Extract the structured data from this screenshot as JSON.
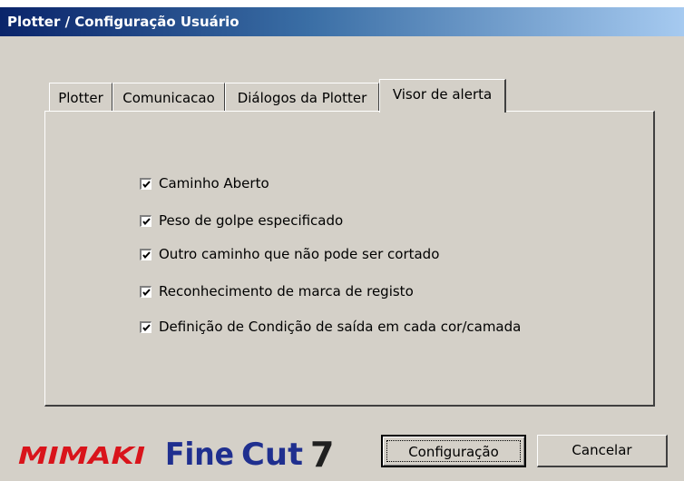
{
  "window": {
    "title": "Plotter / Configuração Usuário"
  },
  "tabs": [
    {
      "label": "Plotter",
      "active": false
    },
    {
      "label": "Comunicacao",
      "active": false
    },
    {
      "label": "Diálogos da Plotter",
      "active": false
    },
    {
      "label": "Visor de alerta",
      "active": true
    }
  ],
  "options": [
    {
      "label": "Caminho Aberto",
      "checked": true
    },
    {
      "label": "Peso de golpe especificado",
      "checked": true
    },
    {
      "label": "Outro caminho que não pode ser cortado",
      "checked": true
    },
    {
      "label": "Reconhecimento de marca de registo",
      "checked": true
    },
    {
      "label": "Definição de Condição de saída em cada cor/camada",
      "checked": true
    }
  ],
  "buttons": {
    "ok_label": "Configuração",
    "cancel_label": "Cancelar"
  },
  "logos": {
    "mimaki": "MIMAKI",
    "finecut_fine": "Fine",
    "finecut_cut": "Cut",
    "finecut_version": "7"
  },
  "colors": {
    "mimaki_red": "#d9141b",
    "finecut_blue": "#1f2f8f",
    "finecut_dark": "#202020"
  }
}
